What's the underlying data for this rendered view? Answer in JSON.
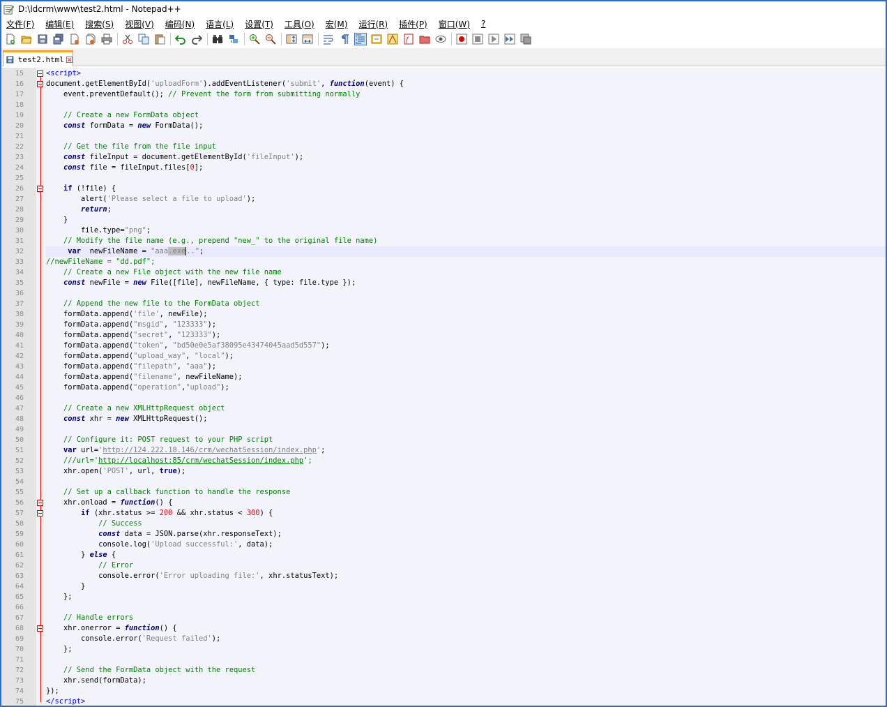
{
  "window": {
    "title": "D:\\ldcrm\\www\\test2.html - Notepad++"
  },
  "menu": [
    "文件(F)",
    "编辑(E)",
    "搜索(S)",
    "视图(V)",
    "编码(N)",
    "语言(L)",
    "设置(T)",
    "工具(O)",
    "宏(M)",
    "运行(R)",
    "插件(P)",
    "窗口(W)",
    "?"
  ],
  "toolbar": {
    "buttons": [
      "new",
      "open",
      "save",
      "save-all",
      "close",
      "close-all",
      "print",
      "cut",
      "copy",
      "paste",
      "undo",
      "redo",
      "find",
      "replace",
      "zoom-in",
      "zoom-out",
      "sync-v",
      "sync-h",
      "word-wrap",
      "show-all-chars",
      "indent-guide",
      "udl",
      "doc-map",
      "function-list",
      "folder-workspace",
      "monitoring",
      "record-macro",
      "stop-macro",
      "play-macro",
      "run-macro-multiple",
      "save-macro"
    ]
  },
  "tab": {
    "label": "test2.html"
  },
  "editor": {
    "lines": [
      {
        "n": "15",
        "html": "<span class='tag'>&lt;script&gt;</span>"
      },
      {
        "n": "16",
        "html": "document.getElementById(<span class='str'>'uploadForm'</span>).addEventListener(<span class='str'>'submit'</span>, <span class='kw'>function</span>(event) {"
      },
      {
        "n": "17",
        "html": "    event.preventDefault(); <span class='cmt'>// Prevent the form from submitting normally</span>"
      },
      {
        "n": "18",
        "html": ""
      },
      {
        "n": "19",
        "html": "    <span class='cmt'>// Create a new FormData object</span>"
      },
      {
        "n": "20",
        "html": "    <span class='kw'>const</span> formData = <span class='kw'>new</span> FormData();"
      },
      {
        "n": "21",
        "html": ""
      },
      {
        "n": "22",
        "html": "    <span class='cmt'>// Get the file from the file input</span>"
      },
      {
        "n": "23",
        "html": "    <span class='kw'>const</span> fileInput = document.getElementById(<span class='str'>'fileInput'</span>);"
      },
      {
        "n": "24",
        "html": "    <span class='kw'>const</span> file = fileInput.files[<span class='num'>0</span>];"
      },
      {
        "n": "25",
        "html": ""
      },
      {
        "n": "26",
        "html": "    <span class='kwn'>if</span> (!file) {"
      },
      {
        "n": "27",
        "html": "        alert(<span class='str'>'Please select a file to upload'</span>);"
      },
      {
        "n": "28",
        "html": "        <span class='kw'>return</span>;"
      },
      {
        "n": "29",
        "html": "    }"
      },
      {
        "n": "30",
        "html": "        file.type=<span class='dstr'>\"png\"</span>;"
      },
      {
        "n": "31",
        "html": "    <span class='cmt'>// Modify the file name (e.g., prepend \"new_\" to the original file name)</span>"
      },
      {
        "n": "32",
        "html": "     <span class='kwn'>var</span>  newFileName = <span class='dstr'>\"aaa<span class='sel'>.exe</span><span class='caret'></span>..\"</span>;"
      },
      {
        "n": "33",
        "html": "<span class='cmt'>//newFileName = \"dd.pdf\";</span>"
      },
      {
        "n": "34",
        "html": "    <span class='cmt'>// Create a new File object with the new file name</span>"
      },
      {
        "n": "35",
        "html": "    <span class='kw'>const</span> newFile = <span class='kw'>new</span> File([file], newFileName, { type: file.type });"
      },
      {
        "n": "36",
        "html": ""
      },
      {
        "n": "37",
        "html": "    <span class='cmt'>// Append the new file to the FormData object</span>"
      },
      {
        "n": "38",
        "html": "    formData.append(<span class='str'>'file'</span>, newFile);"
      },
      {
        "n": "39",
        "html": "    formData.append(<span class='dstr'>\"msgid\"</span>, <span class='dstr'>\"123333\"</span>);"
      },
      {
        "n": "40",
        "html": "    formData.append(<span class='dstr'>\"secret\"</span>, <span class='dstr'>\"123333\"</span>);"
      },
      {
        "n": "41",
        "html": "    formData.append(<span class='dstr'>\"token\"</span>, <span class='dstr'>\"bd50e0e5af38095e43474045aad5d557\"</span>);"
      },
      {
        "n": "42",
        "html": "    formData.append(<span class='dstr'>\"upload_way\"</span>, <span class='dstr'>\"local\"</span>);"
      },
      {
        "n": "43",
        "html": "    formData.append(<span class='dstr'>\"filepath\"</span>, <span class='dstr'>\"aaa\"</span>);"
      },
      {
        "n": "44",
        "html": "    formData.append(<span class='dstr'>\"filename\"</span>, newFileName);"
      },
      {
        "n": "45",
        "html": "    formData.append(<span class='dstr'>\"operation\"</span>,<span class='dstr'>\"upload\"</span>);"
      },
      {
        "n": "46",
        "html": ""
      },
      {
        "n": "47",
        "html": "    <span class='cmt'>// Create a new XMLHttpRequest object</span>"
      },
      {
        "n": "48",
        "html": "    <span class='kw'>const</span> xhr = <span class='kw'>new</span> XMLHttpRequest();"
      },
      {
        "n": "49",
        "html": ""
      },
      {
        "n": "50",
        "html": "    <span class='cmt'>// Configure it: POST request to your PHP script</span>"
      },
      {
        "n": "51",
        "html": "    <span class='kwn'>var</span> url=<span class='str'>'<span class='link'>http://124.222.18.146/crm/wechatSession/index.php</span>'</span>;"
      },
      {
        "n": "52",
        "html": "    <span class='cmt'>///url='<span class='link' style='color:#008000'>http://localhost:85/crm/wechatSession/index.php</span>';</span>"
      },
      {
        "n": "53",
        "html": "    xhr.open(<span class='str'>'POST'</span>, url, <span class='kwn'>true</span>);"
      },
      {
        "n": "54",
        "html": ""
      },
      {
        "n": "55",
        "html": "    <span class='cmt'>// Set up a callback function to handle the response</span>"
      },
      {
        "n": "56",
        "html": "    xhr.onload = <span class='kw'>function</span>() {"
      },
      {
        "n": "57",
        "html": "        <span class='kwn'>if</span> (xhr.status &gt;= <span class='num'>200</span> &amp;&amp; xhr.status &lt; <span class='num'>300</span>) {"
      },
      {
        "n": "58",
        "html": "            <span class='cmt'>// Success</span>"
      },
      {
        "n": "59",
        "html": "            <span class='kw'>const</span> data = JSON.parse(xhr.responseText);"
      },
      {
        "n": "60",
        "html": "            console.log(<span class='str'>'Upload successful:'</span>, data);"
      },
      {
        "n": "61",
        "html": "        } <span class='kw'>else</span> {"
      },
      {
        "n": "62",
        "html": "            <span class='cmt'>// Error</span>"
      },
      {
        "n": "63",
        "html": "            console.error(<span class='str'>'Error uploading file:'</span>, xhr.statusText);"
      },
      {
        "n": "64",
        "html": "        }"
      },
      {
        "n": "65",
        "html": "    };"
      },
      {
        "n": "66",
        "html": ""
      },
      {
        "n": "67",
        "html": "    <span class='cmt'>// Handle errors</span>"
      },
      {
        "n": "68",
        "html": "    xhr.onerror = <span class='kw'>function</span>() {"
      },
      {
        "n": "69",
        "html": "        console.error(<span class='str'>'Request failed'</span>);"
      },
      {
        "n": "70",
        "html": "    };"
      },
      {
        "n": "71",
        "html": ""
      },
      {
        "n": "72",
        "html": "    <span class='cmt'>// Send the FormData object with the request</span>"
      },
      {
        "n": "73",
        "html": "    xhr.send(formData);"
      },
      {
        "n": "74",
        "html": "});"
      },
      {
        "n": "75",
        "html": "<span class='tag'>&lt;/script&gt;</span>"
      }
    ],
    "fold_markers": [
      "15",
      "16",
      "26",
      "56",
      "57",
      "68"
    ],
    "current_line": "32"
  }
}
